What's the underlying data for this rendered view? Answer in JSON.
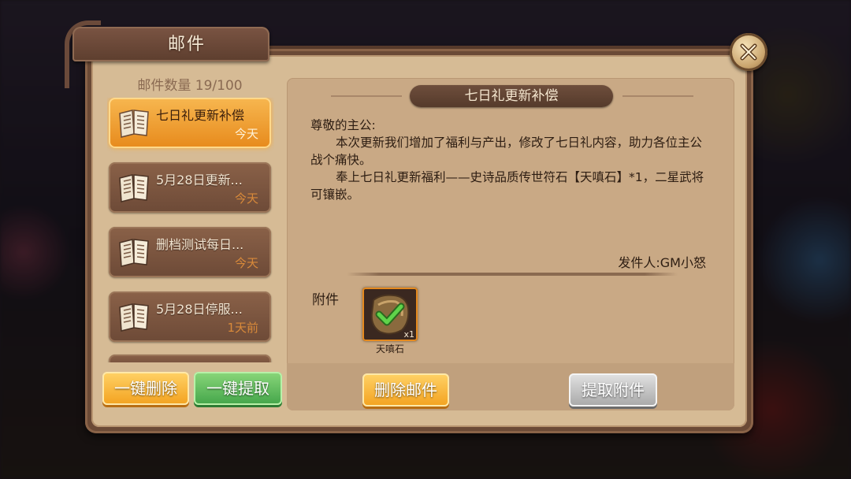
{
  "window": {
    "title": "邮件"
  },
  "mail_list": {
    "count_label": "邮件数量 19/100",
    "items": [
      {
        "subject": "七日礼更新补偿",
        "date": "今天",
        "selected": true
      },
      {
        "subject": "5月28日更新...",
        "date": "今天",
        "selected": false
      },
      {
        "subject": "删档测试每日...",
        "date": "今天",
        "selected": false
      },
      {
        "subject": "5月28日停服...",
        "date": "1天前",
        "selected": false
      }
    ]
  },
  "actions": {
    "delete_all": "一键删除",
    "collect_all": "一键提取",
    "delete_mail": "删除邮件",
    "collect_attachment": "提取附件"
  },
  "mail": {
    "subject": "七日礼更新补偿",
    "greeting": "尊敬的主公:",
    "paragraph1": "本次更新我们增加了福利与产出，修改了七日礼内容，助力各位主公战个痛快。",
    "paragraph2": "奉上七日礼更新福利——史诗品质传世符石【天嗔石】*1，二星武将可镶嵌。",
    "sender": "发件人:GM小怒",
    "attachment_label": "附件",
    "attachments": [
      {
        "name": "天嗔石",
        "quantity": "x1",
        "icon": "rune-stone-icon",
        "claimed": true
      }
    ]
  },
  "colors": {
    "accent_orange": "#f3a21f",
    "accent_green": "#43a54a",
    "panel": "#d6bb95",
    "frame": "#6b4a36"
  }
}
